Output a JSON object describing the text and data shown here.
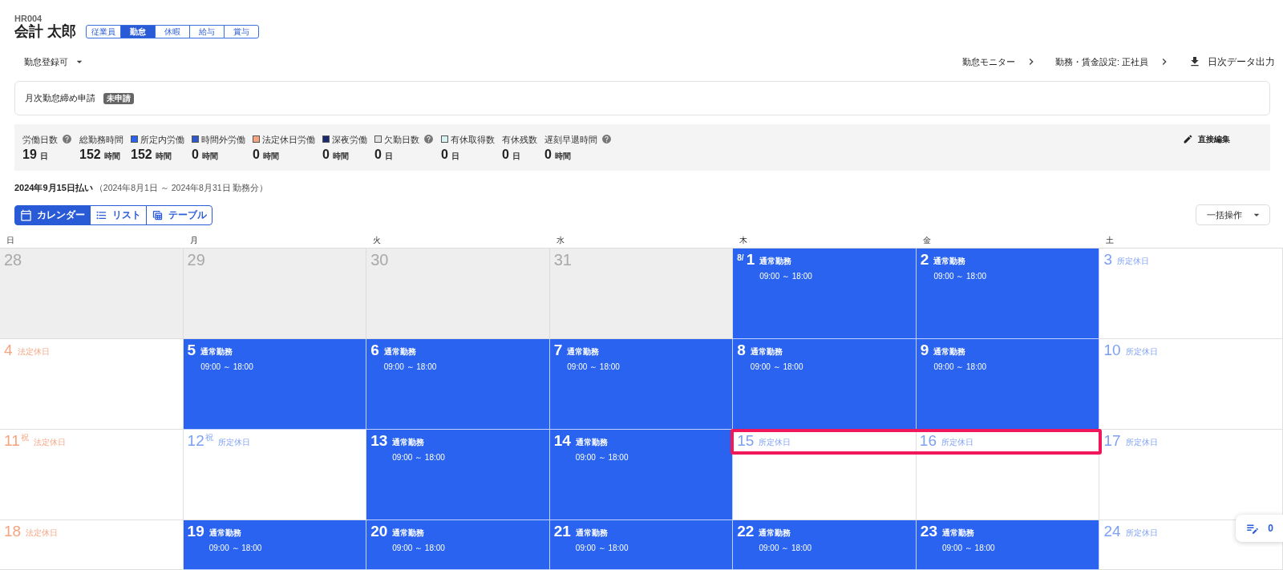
{
  "employee": {
    "id": "HR004",
    "name": "会計 太郎",
    "tabs": [
      {
        "label": "従業員",
        "selected": false
      },
      {
        "label": "勤怠",
        "selected": true
      },
      {
        "label": "休暇",
        "selected": false
      },
      {
        "label": "給与",
        "selected": false
      },
      {
        "label": "賞与",
        "selected": false
      }
    ]
  },
  "status_dropdown": {
    "value": "勤怠登録可"
  },
  "header_links": [
    {
      "kind": "link",
      "label": "勤怠モニター"
    },
    {
      "kind": "link",
      "label": "勤務・賃金設定: 正社員"
    },
    {
      "kind": "download",
      "label": "日次データ出力"
    }
  ],
  "request_card": {
    "title": "月次勤怠締め申請",
    "badge": "未申請"
  },
  "summary": {
    "items": [
      {
        "label": "労働日数",
        "help": true,
        "value": "19",
        "unit": "日"
      },
      {
        "label": "総勤務時間",
        "help": false,
        "value": "152",
        "unit": "時間"
      },
      {
        "label": "所定内労働",
        "help": false,
        "color": "#2963ef",
        "value": "152",
        "unit": "時間"
      },
      {
        "label": "時間外労働",
        "help": false,
        "color": "#2f58cc",
        "value": "0",
        "unit": "時間"
      },
      {
        "label": "法定休日労働",
        "help": false,
        "color": "#f6a37f",
        "value": "0",
        "unit": "時間"
      },
      {
        "label": "深夜労働",
        "help": false,
        "color": "#1b2a6e",
        "value": "0",
        "unit": "時間"
      },
      {
        "label": "欠勤日数",
        "help": true,
        "color": "#e2e2e2",
        "value": "0",
        "unit": "日"
      },
      {
        "label": "有休取得数",
        "help": false,
        "color": "#d7f2f3",
        "value": "0",
        "unit": "日"
      },
      {
        "label": "有休残数",
        "help": false,
        "value": "0",
        "unit": "日"
      },
      {
        "label": "遅刻早退時間",
        "help": true,
        "value": "0",
        "unit": "時間"
      }
    ],
    "edit_button": "直接編集"
  },
  "period": {
    "pay_date": "2024年9月15日払い",
    "range": "（2024年8月1日 ～ 2024年8月31日 勤務分）"
  },
  "view_tabs": [
    {
      "kind": "calendar",
      "label": "カレンダー",
      "selected": true
    },
    {
      "kind": "list",
      "label": "リスト",
      "selected": false
    },
    {
      "kind": "table",
      "label": "テーブル",
      "selected": false
    }
  ],
  "bulk_button": "一括操作",
  "calendar": {
    "weekdays": [
      "日",
      "月",
      "火",
      "水",
      "木",
      "金",
      "土"
    ],
    "weeks": [
      {
        "days": [
          {
            "day": "28",
            "kind": "outside",
            "highlighted": false
          },
          {
            "day": "29",
            "kind": "outside",
            "highlighted": false
          },
          {
            "day": "30",
            "kind": "outside",
            "highlighted": false
          },
          {
            "day": "31",
            "kind": "outside",
            "highlighted": false
          },
          {
            "day": "1",
            "prefix": "8/",
            "kind": "work",
            "label": "通常勤務",
            "time": "09:00 ～ 18:00",
            "highlighted": false
          },
          {
            "day": "2",
            "kind": "work",
            "label": "通常勤務",
            "time": "09:00 ～ 18:00",
            "highlighted": false
          },
          {
            "day": "3",
            "kind": "scheduled_off",
            "label": "所定休日",
            "highlighted": false
          }
        ]
      },
      {
        "days": [
          {
            "day": "4",
            "kind": "legal_off",
            "label": "法定休日",
            "highlighted": false
          },
          {
            "day": "5",
            "kind": "work",
            "label": "通常勤務",
            "time": "09:00 ～ 18:00",
            "highlighted": false
          },
          {
            "day": "6",
            "kind": "work",
            "label": "通常勤務",
            "time": "09:00 ～ 18:00",
            "highlighted": false
          },
          {
            "day": "7",
            "kind": "work",
            "label": "通常勤務",
            "time": "09:00 ～ 18:00",
            "highlighted": false
          },
          {
            "day": "8",
            "kind": "work",
            "label": "通常勤務",
            "time": "09:00 ～ 18:00",
            "highlighted": false
          },
          {
            "day": "9",
            "kind": "work",
            "label": "通常勤務",
            "time": "09:00 ～ 18:00",
            "highlighted": false
          },
          {
            "day": "10",
            "kind": "scheduled_off",
            "label": "所定休日",
            "highlighted": false
          }
        ]
      },
      {
        "days": [
          {
            "day": "11",
            "mark": "祝",
            "kind": "legal_off",
            "label": "法定休日",
            "highlighted": false
          },
          {
            "day": "12",
            "mark": "祝",
            "kind": "scheduled_off",
            "label": "所定休日",
            "highlighted": false
          },
          {
            "day": "13",
            "kind": "work",
            "label": "通常勤務",
            "time": "09:00 ～ 18:00",
            "highlighted": false
          },
          {
            "day": "14",
            "kind": "work",
            "label": "通常勤務",
            "time": "09:00 ～ 18:00",
            "highlighted": false
          },
          {
            "day": "15",
            "kind": "scheduled_off",
            "label": "所定休日",
            "highlighted": true
          },
          {
            "day": "16",
            "kind": "scheduled_off",
            "label": "所定休日",
            "highlighted": true
          },
          {
            "day": "17",
            "kind": "scheduled_off",
            "label": "所定休日",
            "highlighted": false
          }
        ]
      },
      {
        "days": [
          {
            "day": "18",
            "kind": "legal_off",
            "label": "法定休日",
            "highlighted": false
          },
          {
            "day": "19",
            "kind": "work",
            "label": "通常勤務",
            "time": "09:00 ～ 18:00",
            "highlighted": false
          },
          {
            "day": "20",
            "kind": "work",
            "label": "通常勤務",
            "time": "09:00 ～ 18:00",
            "highlighted": false
          },
          {
            "day": "21",
            "kind": "work",
            "label": "通常勤務",
            "time": "09:00 ～ 18:00",
            "highlighted": false
          },
          {
            "day": "22",
            "kind": "work",
            "label": "通常勤務",
            "time": "09:00 ～ 18:00",
            "highlighted": false
          },
          {
            "day": "23",
            "kind": "work",
            "label": "通常勤務",
            "time": "09:00 ～ 18:00",
            "highlighted": false
          },
          {
            "day": "24",
            "kind": "scheduled_off",
            "label": "所定休日",
            "highlighted": false
          }
        ]
      }
    ]
  },
  "floating_button": {
    "count": "0"
  }
}
